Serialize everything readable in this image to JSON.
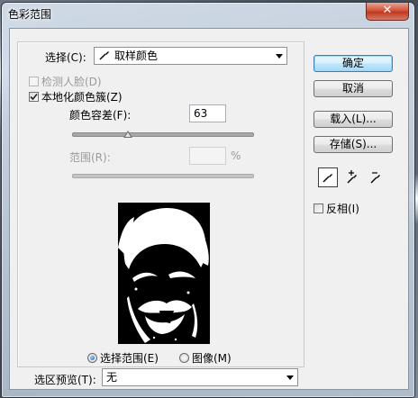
{
  "window": {
    "title": "色彩范围",
    "close_glyph": "✕"
  },
  "select": {
    "label": "选择(C):",
    "value": "取样颜色",
    "icon": "eyedropper-icon"
  },
  "detect_faces": {
    "label": "检测人脸(D)",
    "checked": false,
    "enabled": false
  },
  "localized": {
    "label": "本地化颜色簇(Z)",
    "checked": true
  },
  "fuzziness": {
    "label": "颜色容差(F):",
    "value": "63",
    "slider_fraction": 0.31
  },
  "range": {
    "label": "范围(R):",
    "value": "",
    "unit": "%",
    "enabled": false
  },
  "view_options": {
    "selection": {
      "label": "选择范围(E)",
      "selected": true
    },
    "image": {
      "label": "图像(M)",
      "selected": false
    }
  },
  "selection_preview": {
    "label": "选区预览(T):",
    "value": "无"
  },
  "buttons": {
    "ok": "确定",
    "cancel": "取消",
    "load": "载入(L)...",
    "save": "存储(S)..."
  },
  "tools": [
    {
      "name": "eyedropper-icon",
      "active": true
    },
    {
      "name": "add-eyedropper-icon",
      "active": false
    },
    {
      "name": "subtract-eyedropper-icon",
      "active": false
    }
  ],
  "invert": {
    "label": "反相(I)",
    "checked": false
  },
  "colors": {
    "default_button_border": "#3c7fb1",
    "close_button": "#c9432a",
    "preview_bg": "#000000"
  }
}
